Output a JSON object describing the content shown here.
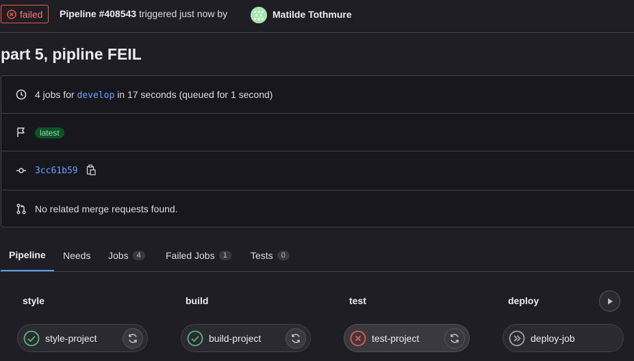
{
  "header": {
    "status": "failed",
    "pipeline_label": "Pipeline #408543",
    "trigger_text": "triggered just now by",
    "author": "Matilde Tothmure"
  },
  "title": "part 5, pipline FEIL",
  "info": {
    "jobs_prefix": "4 jobs for",
    "branch": "develop",
    "jobs_suffix": "in 17 seconds (queued for 1 second)",
    "tag": "latest",
    "commit": "3cc61b59",
    "merge_requests": "No related merge requests found."
  },
  "tabs": [
    {
      "label": "Pipeline"
    },
    {
      "label": "Needs"
    },
    {
      "label": "Jobs",
      "count": "4"
    },
    {
      "label": "Failed Jobs",
      "count": "1"
    },
    {
      "label": "Tests",
      "count": "0"
    }
  ],
  "stages": [
    {
      "title": "style",
      "job": "style-project",
      "status": "success"
    },
    {
      "title": "build",
      "job": "build-project",
      "status": "success"
    },
    {
      "title": "test",
      "job": "test-project",
      "status": "failed"
    },
    {
      "title": "deploy",
      "job": "deploy-job",
      "status": "skipped"
    }
  ],
  "colors": {
    "failed": "#ec5941",
    "success": "#52b87a",
    "link": "#65a3ff",
    "tab_underline": "#5b9bf2"
  }
}
